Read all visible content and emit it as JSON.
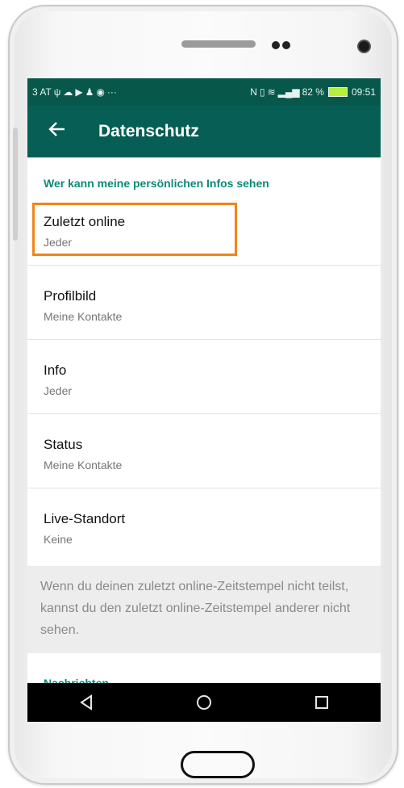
{
  "status_bar": {
    "carrier": "3 AT",
    "left_icons": [
      "usb-icon",
      "cloud-icon",
      "play-icon",
      "person-icon",
      "chrome-icon",
      "more-icon"
    ],
    "nfc": "N",
    "battery": "82 %",
    "time": "09:51"
  },
  "app_bar": {
    "title": "Datenschutz"
  },
  "section": {
    "header": "Wer kann meine persönlichen Infos sehen",
    "items": [
      {
        "label": "Zuletzt online",
        "value": "Jeder"
      },
      {
        "label": "Profilbild",
        "value": "Meine Kontakte"
      },
      {
        "label": "Info",
        "value": "Jeder"
      },
      {
        "label": "Status",
        "value": "Meine Kontakte"
      },
      {
        "label": "Live-Standort",
        "value": "Keine"
      }
    ]
  },
  "info_text": "Wenn du deinen zuletzt online-Zeitstempel nicht teilst, kannst du den zuletzt online-Zeitstempel anderer nicht sehen.",
  "next_section": {
    "header": "Nachrichten"
  },
  "nav": {
    "buttons": [
      "back-triangle-icon",
      "home-circle-icon",
      "recents-square-icon"
    ]
  },
  "colors": {
    "app_bar": "#075e54",
    "status_bar": "#07574b",
    "accent": "#0d8a78",
    "highlight": "#f0851a"
  }
}
